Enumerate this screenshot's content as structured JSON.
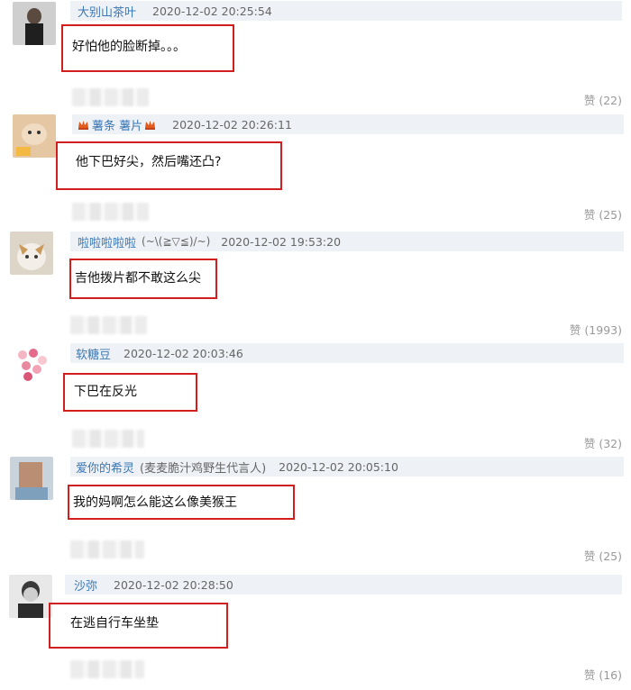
{
  "comments": [
    {
      "user": "大别山茶叶",
      "time": "2020-12-02 20:25:54",
      "text": "好怕他的脸断掉。。。",
      "likes": "(22)",
      "like_label": "赞"
    },
    {
      "user": "薯条 薯片",
      "time": "2020-12-02 20:26:11",
      "text": "他下巴好尖，然后嘴还凸?",
      "likes": "(25)",
      "like_label": "赞"
    },
    {
      "user": "啦啦啦啦啦",
      "user_suffix": "(~\\(≧▽≦)/~)",
      "time": "2020-12-02 19:53:20",
      "text": "吉他拨片都不敢这么尖",
      "likes": "(1993)",
      "like_label": "赞"
    },
    {
      "user": "软糖豆",
      "time": "2020-12-02 20:03:46",
      "text": "下巴在反光",
      "likes": "(32)",
      "like_label": "赞"
    },
    {
      "user": "爱你的希灵",
      "user_suffix": "(麦麦脆汁鸡野生代言人)",
      "time": "2020-12-02 20:05:10",
      "text": "我的妈啊怎么能这么像美猴王",
      "likes": "(25)",
      "like_label": "赞"
    },
    {
      "user": "沙弥",
      "time": "2020-12-02 20:28:50",
      "text": "在逃自行车坐垫",
      "likes": "(16)",
      "like_label": "赞"
    }
  ],
  "colors": {
    "highlight": "#d11f1f",
    "username": "#3b78b4",
    "meta_bg": "#eef1f5"
  }
}
